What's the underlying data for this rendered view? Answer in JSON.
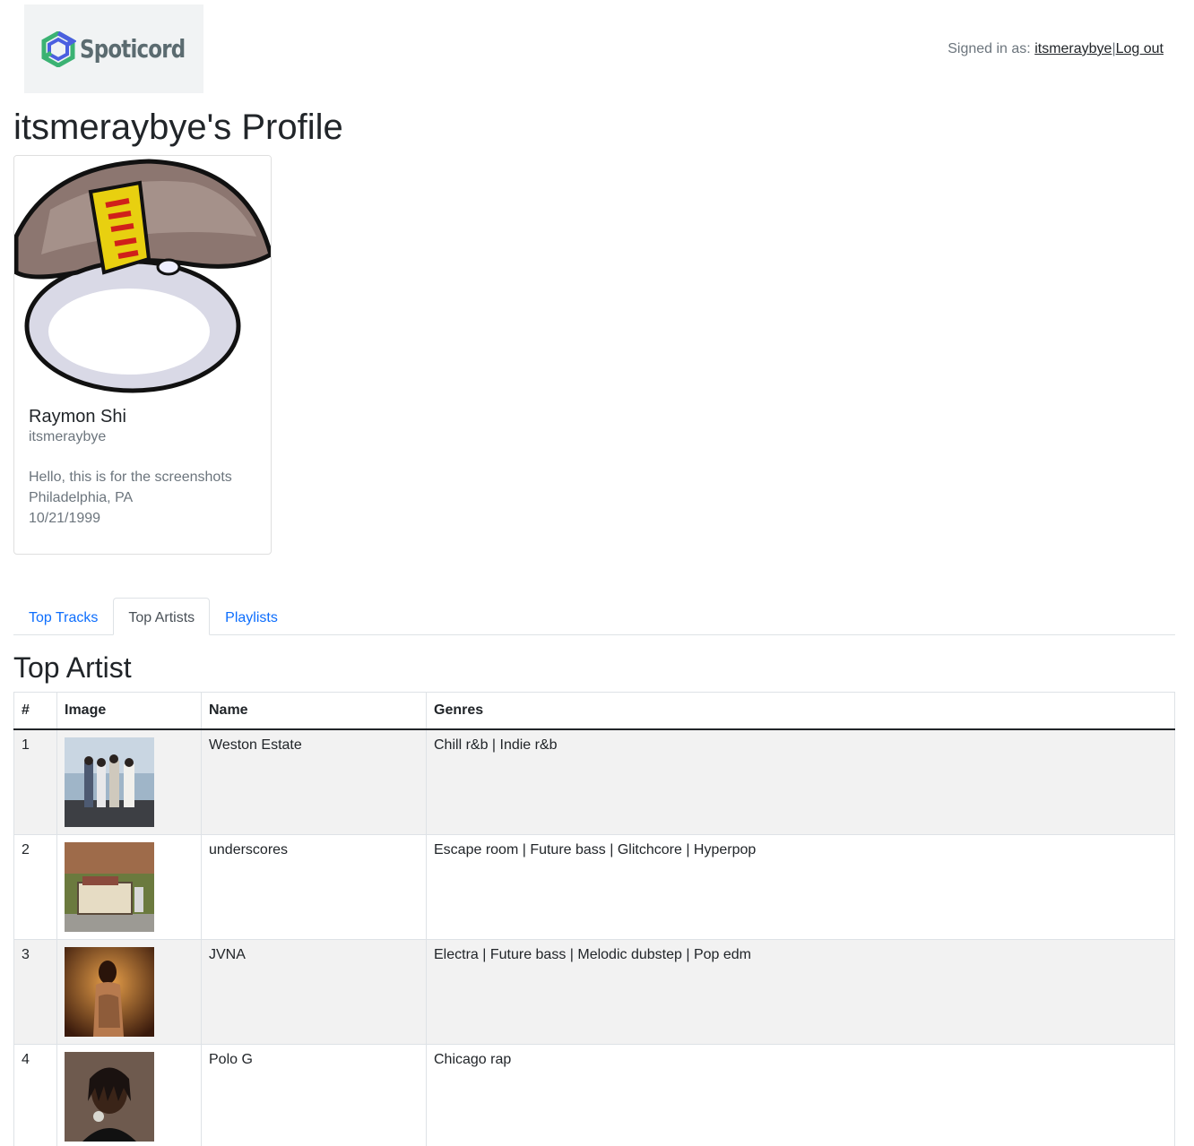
{
  "header": {
    "logo_text": "Spoticord",
    "signed_in_prefix": "Signed in as:",
    "username_link": "itsmeraybye",
    "separator": "|",
    "logout_link": "Log out"
  },
  "profile": {
    "title": "itsmeraybye's Profile",
    "display_name": "Raymon Shi",
    "username": "itsmeraybye",
    "bio": "Hello, this is for the screenshots",
    "location": "Philadelphia, PA",
    "birthday": "10/21/1999"
  },
  "tabs": [
    {
      "label": "Top Tracks",
      "active": false
    },
    {
      "label": "Top Artists",
      "active": true
    },
    {
      "label": "Playlists",
      "active": false
    }
  ],
  "section": {
    "title": "Top Artist"
  },
  "table": {
    "headers": [
      "#",
      "Image",
      "Name",
      "Genres"
    ],
    "rows": [
      {
        "rank": "1",
        "name": "Weston Estate",
        "genres": "Chill r&b | Indie r&b",
        "image": "weston-estate-photo"
      },
      {
        "rank": "2",
        "name": "underscores",
        "genres": "Escape room | Future bass | Glitchcore | Hyperpop",
        "image": "underscores-photo"
      },
      {
        "rank": "3",
        "name": "JVNA",
        "genres": "Electra | Future bass | Melodic dubstep | Pop edm",
        "image": "jvna-photo"
      },
      {
        "rank": "4",
        "name": "Polo G",
        "genres": "Chicago rap",
        "image": "polo-g-photo"
      }
    ]
  },
  "colors": {
    "link": "#0d6efd",
    "muted": "#6c757d",
    "stripe": "#f2f2f2",
    "logo_green": "#3bb273",
    "logo_blue": "#4b5fe0"
  }
}
